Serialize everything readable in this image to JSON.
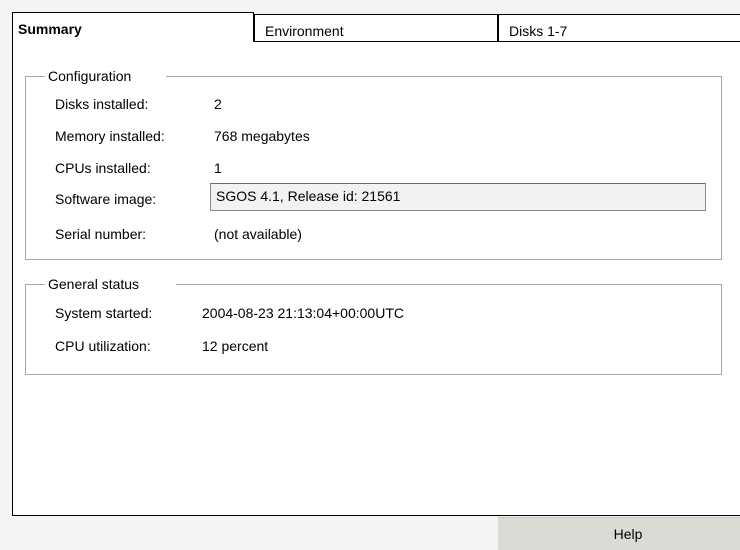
{
  "tabs": {
    "summary": "Summary",
    "environment": "Environment",
    "disks": "Disks 1-7"
  },
  "configuration": {
    "legend": "Configuration",
    "disks_label": "Disks installed:",
    "disks_value": "2",
    "memory_label": "Memory installed:",
    "memory_value": "768 megabytes",
    "cpus_label": "CPUs installed:",
    "cpus_value": "1",
    "software_label": "Software image:",
    "software_value": "SGOS 4.1, Release id: 21561",
    "serial_label": "Serial number:",
    "serial_value": "(not available)"
  },
  "general_status": {
    "legend": "General status",
    "started_label": "System started:",
    "started_value": "2004-08-23 21:13:04+00:00UTC",
    "cpu_label": "CPU utilization:",
    "cpu_value": "12 percent"
  },
  "buttons": {
    "help": "Help"
  }
}
